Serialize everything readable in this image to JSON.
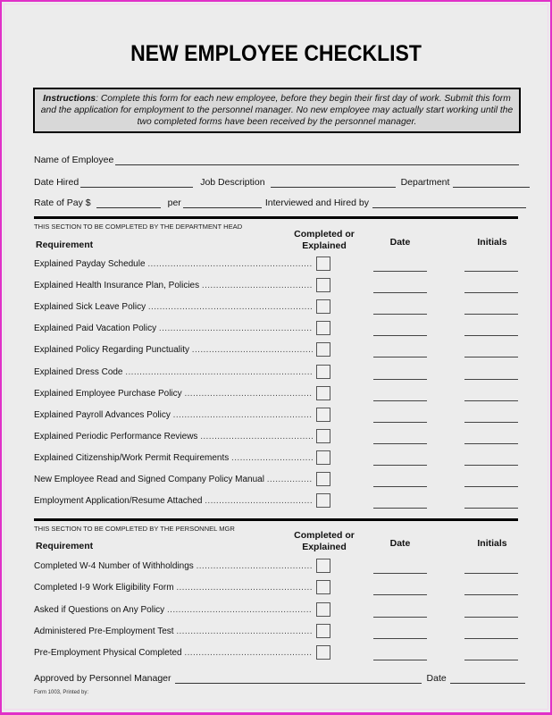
{
  "document": {
    "title": "NEW EMPLOYEE CHECKLIST",
    "instructions": {
      "label": "Instructions",
      "text": ":  Complete this form for each new employee, before they begin their first day of work.  Submit this form and the application for employment to the personnel manager.  No new employee may actually start working until the two completed forms have been received by the personnel manager."
    },
    "fields": {
      "name_of_employee": "Name of Employee",
      "date_hired": "Date Hired",
      "job_description": "Job Description",
      "department": "Department",
      "rate_of_pay": "Rate of Pay $",
      "per": "per",
      "interviewed_and_hired_by": "Interviewed and Hired by"
    },
    "columns": {
      "requirement": "Requirement",
      "completed_line1": "Completed or",
      "completed_line2": "Explained",
      "date": "Date",
      "initials": "Initials"
    },
    "section1": {
      "note": "THIS SECTION TO BE COMPLETED BY THE DEPARTMENT HEAD",
      "items": [
        {
          "label": "Explained Payday Schedule",
          "checked": false
        },
        {
          "label": "Explained Health Insurance Plan, Policies",
          "checked": false
        },
        {
          "label": "Explained Sick Leave Policy",
          "checked": false
        },
        {
          "label": "Explained Paid Vacation Policy",
          "checked": false
        },
        {
          "label": "Explained Policy Regarding Punctuality",
          "checked": false
        },
        {
          "label": "Explained Dress Code",
          "checked": false
        },
        {
          "label": "Explained Employee Purchase Policy",
          "checked": false
        },
        {
          "label": "Explained Payroll Advances Policy",
          "checked": false
        },
        {
          "label": "Explained Periodic Performance Reviews",
          "checked": false
        },
        {
          "label": "Explained Citizenship/Work Permit Requirements",
          "checked": false
        },
        {
          "label": "New Employee Read and Signed Company Policy Manual",
          "checked": false
        },
        {
          "label": "Employment Application/Resume Attached",
          "checked": false
        }
      ]
    },
    "section2": {
      "note": "THIS SECTION TO BE COMPLETED BY THE PERSONNEL MGR",
      "items": [
        {
          "label": "Completed W-4 Number of Withholdings",
          "checked": false
        },
        {
          "label": "Completed I-9 Work Eligibility Form",
          "checked": false
        },
        {
          "label": "Asked if Questions on Any Policy",
          "checked": false
        },
        {
          "label": "Administered Pre-Employment Test",
          "checked": false
        },
        {
          "label": "Pre-Employment Physical Completed",
          "checked": false
        }
      ]
    },
    "approval": {
      "approved_by": "Approved by Personnel Manager",
      "date": "Date"
    },
    "footer": "Form 1003, Printed by:",
    "dots": "........................................................................................................................"
  }
}
